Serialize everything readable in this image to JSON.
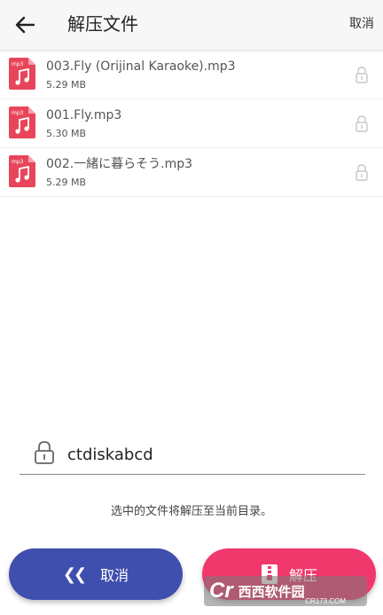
{
  "header": {
    "title": "解压文件",
    "cancel_label": "取消"
  },
  "files": [
    {
      "icon_label": "mp3",
      "name": "003.Fly (Orijinal Karaoke).mp3",
      "size": "5.29 MB"
    },
    {
      "icon_label": "mp3",
      "name": "001.Fly.mp3",
      "size": "5.30 MB"
    },
    {
      "icon_label": "mp3",
      "name": "002.一緒に暮らそう.mp3",
      "size": "5.29 MB"
    }
  ],
  "password": {
    "value": "ctdiskabcd"
  },
  "info_text": "选中的文件将解压至当前目录。",
  "buttons": {
    "cancel_label": "取消",
    "extract_label": "解压"
  },
  "watermark": {
    "brand": "西西软件园",
    "url": "CR173.COM"
  },
  "colors": {
    "cancel_button": "#3f4fad",
    "extract_button": "#f0386d",
    "file_icon": "#e8455a"
  }
}
